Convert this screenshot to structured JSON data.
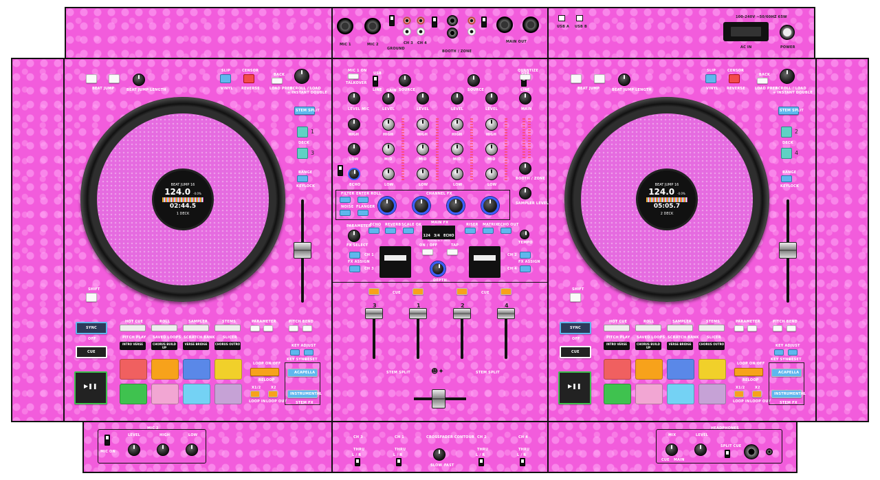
{
  "rear": {
    "mic1": "MIC 1",
    "mic2": "MIC 2",
    "ground": "GROUND",
    "ch3": "CH 3",
    "ch4": "CH 4",
    "booth": "BOOTH / ZONE",
    "main_out": "MAIN OUT",
    "usb_a": "USB A",
    "usb_b": "USB B",
    "ac_in": "AC IN",
    "power": "POWER",
    "voltage": "100-240V ~50/60Hz 65W"
  },
  "deck": {
    "beat_jump": "BEAT JUMP",
    "beat_jump_length": "BEAT JUMP LENGTH",
    "slip": "SLIP",
    "vinyl": "VINYL",
    "censor": "CENSOR",
    "reverse": "REVERSE",
    "back": "BACK",
    "load_prep": "LOAD PREP",
    "scroll": "SCROLL / LOAD",
    "instant_double": "+ INSTANT DOUBLE",
    "stem_split": "STEM SPLIT",
    "deck": "DECK",
    "range": "RANGE",
    "keylock": "KEYLOCK",
    "shift": "SHIFT",
    "sync": "SYNC",
    "off": "OFF",
    "cue": "CUE",
    "hot_cue": "HOT CUE",
    "roll": "ROLL",
    "sampler": "SAMPLER",
    "stems": "STEMS",
    "pitch_play": "PITCH PLAY",
    "saved_loops": "SAVED LOOPS",
    "scratch_bank": "SCRATCH BANK",
    "slicer": "SLICER",
    "sub1": "INTRO VERSE",
    "sub2": "CHORUS BUILD UP",
    "sub3": "VERSE BRIDGE",
    "sub4": "CHORUS OUTRO",
    "parameter": "PARAMETER",
    "pitch_bend": "PITCH BEND",
    "key_adjust": "KEY ADJUST",
    "key_sync": "KEY SYNC",
    "reset": "RESET",
    "loop_onoff": "LOOP ON/OFF",
    "reloop": "RELOOP",
    "half": "x1/2",
    "x2": "x2",
    "loop_in": "LOOP IN",
    "loop_out": "LOOP OUT",
    "acapella": "ACAPELLA",
    "instrumental": "INSTRUMENTAL",
    "stem_fx": "STEM FX"
  },
  "left_screen": {
    "title": "BEAT JUMP 16",
    "bpm": "124.0",
    "pitch": "-0.0%",
    "time": "02:44.5",
    "deck": "1 DECK"
  },
  "right_screen": {
    "title": "BEAT JUMP 16",
    "bpm": "124.0",
    "pitch": "-0.0%",
    "time": "05:05.7",
    "deck": "2 DECK"
  },
  "mixer": {
    "mic_on": "MIC 1 ON",
    "talkover": "TALKOVER",
    "usb": "USB",
    "line": "LINE",
    "source": "SOURCE",
    "quantize": "QUANTIZE",
    "gain": "GAIN",
    "level": "LEVEL",
    "mic": "MIC",
    "high": "HIGH",
    "mid": "MID",
    "low": "LOW",
    "main": "MAIN",
    "echo": "ECHO",
    "booth_zone": "BOOTH / ZONE",
    "sampler_level": "SAMPLER LEVEL",
    "filter": "FILTER",
    "enter_roll": "ENTER ROLL",
    "noise": "NOISE",
    "flanger": "FLANGER",
    "channel_fx": "CHANNEL FX",
    "fx_param": "PARAMETER",
    "fx_select": "FX SELECT",
    "reverb": "REVERB",
    "scale_ok": "SCALE OK",
    "riser": "RISER",
    "matrix": "MATRIX",
    "echo_out": "ECHO OUT",
    "main_fx": "MAIN FX",
    "fx_bpm": "124",
    "fx_beats": "3/4",
    "fx_res": "ECHO",
    "fx_sub": "RESONANCE: MED",
    "on_off": "ON / OFF",
    "tap": "TAP",
    "depth": "DEPTH",
    "tempo": "TEMPO",
    "ch1": "CH 1",
    "ch2": "CH 2",
    "ch3": "CH 3",
    "ch4": "CH 4",
    "fx_assign": "FX ASSIGN",
    "cue": "CUE",
    "stem_split": "STEM SPLIT",
    "ch_nums": [
      "3",
      "1",
      "2",
      "4"
    ]
  },
  "front": {
    "mic2": "MIC 2",
    "mic_on": "MIC ON",
    "level": "LEVEL",
    "high": "HIGH",
    "low": "LOW",
    "ch3": "CH 3",
    "ch1": "CH 1",
    "ch2": "CH 2",
    "ch4": "CH 4",
    "thru": "THRU",
    "lr": "L / R",
    "crossfader_contour": "CROSSFADER CONTOUR",
    "slow": "SLOW",
    "fast": "FAST",
    "headphones": "HEADPHONES",
    "mix": "MIX",
    "cue": "CUE",
    "main": "MAIN",
    "split_cue": "SPLIT CUE"
  },
  "colors": {
    "base": "#f25cdc",
    "accent": "#5fb7ee",
    "pad_red": "#f06060",
    "pad_orange": "#f7a21b",
    "pad_blue": "#5a88e8",
    "pad_yellow": "#f1d02a",
    "pad_green": "#3fc24f",
    "pad_pink": "#f2a6d3",
    "pad_cyan": "#74d2f4",
    "pad_mauve": "#c6a2d6"
  }
}
